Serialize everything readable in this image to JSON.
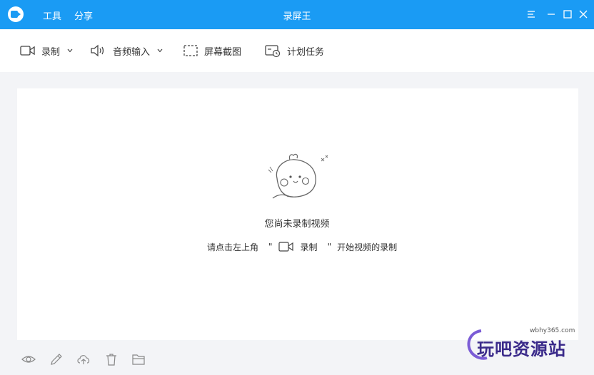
{
  "titlebar": {
    "menu": [
      "工具",
      "分享"
    ],
    "title": "录屏王"
  },
  "toolbar": {
    "record_label": "录制",
    "audio_label": "音频输入",
    "screenshot_label": "屏幕截图",
    "schedule_label": "计划任务"
  },
  "empty_state": {
    "title": "您尚未录制视频",
    "hint_prefix": "请点击左上角",
    "hint_quote_open": "\"",
    "hint_record": "录制",
    "hint_quote_close": "\"",
    "hint_suffix": "开始视频的录制"
  },
  "bottom_icons": [
    "eye-icon",
    "pencil-icon",
    "upload-icon",
    "trash-icon",
    "folder-icon"
  ],
  "watermark": {
    "url": "wbhy365.com",
    "text": "玩吧资源站"
  },
  "colors": {
    "accent": "#1a9bf4",
    "background": "#f3f4f7"
  }
}
